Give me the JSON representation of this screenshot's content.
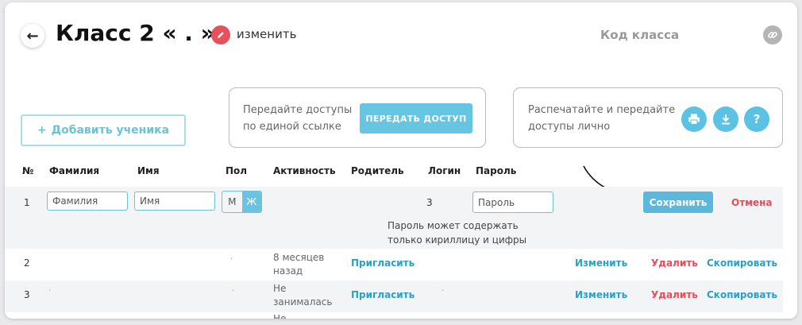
{
  "header": {
    "title": "Класс 2 « . »",
    "edit_label": "изменить",
    "class_code_label": "Код класса"
  },
  "toolbar": {
    "add_student_label": "Добавить ученика",
    "share_text_line1": "Передайте доступы",
    "share_text_line2": "по единой ссылке",
    "share_button_label": "ПЕРЕДАТЬ ДОСТУП",
    "print_text_line1": "Распечатайте и передайте",
    "print_text_line2": "доступы лично",
    "help_label": "?"
  },
  "table": {
    "headers": {
      "num": "№",
      "surname": "Фамилия",
      "name": "Имя",
      "gender": "Пол",
      "activity": "Активность",
      "parent": "Родитель",
      "login": "Логин",
      "password": "Пароль"
    },
    "edit_row": {
      "num": "1",
      "surname_placeholder": "Фамилия",
      "name_placeholder": "Имя",
      "gender_m": "М",
      "gender_f": "Ж",
      "login": "3",
      "password_placeholder": "Пароль",
      "save_label": "Сохранить",
      "cancel_label": "Отмена",
      "hint_line1": "Пароль может содержать",
      "hint_line2": "только кириллицу и цифры"
    },
    "rows": [
      {
        "num": "2",
        "activity_line1": "8 месяцев",
        "activity_line2": "назад",
        "invite_label": "Пригласить",
        "edit_label": "Изменить",
        "delete_label": "Удалить",
        "copy_label": "Скопировать"
      },
      {
        "num": "3",
        "activity_line1": "Не",
        "activity_line2": "занималась",
        "invite_label": "Пригласить",
        "edit_label": "Изменить",
        "delete_label": "Удалить",
        "copy_label": "Скопировать"
      }
    ],
    "partial_row": {
      "activity_line1": "Не"
    }
  }
}
